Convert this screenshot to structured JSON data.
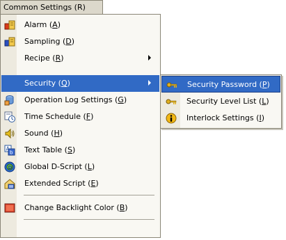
{
  "menubar": {
    "label": "Common Settings (R)"
  },
  "menu": {
    "items": [
      {
        "label": "Alarm (",
        "key": "A",
        "tail": ")",
        "icon": "alarm-icon"
      },
      {
        "label": "Sampling (",
        "key": "D",
        "tail": ")",
        "icon": "sampling-icon"
      },
      {
        "label": "Recipe (",
        "key": "R",
        "tail": ")",
        "icon": ""
      },
      {
        "label": "Security (",
        "key": "Q",
        "tail": ")",
        "icon": ""
      },
      {
        "label": "Operation Log Settings (",
        "key": "G",
        "tail": ")",
        "icon": "operation-log-icon"
      },
      {
        "label": "Time Schedule (",
        "key": "F",
        "tail": ")",
        "icon": "time-schedule-icon"
      },
      {
        "label": "Sound (",
        "key": "H",
        "tail": ")",
        "icon": "sound-icon"
      },
      {
        "label": "Text Table (",
        "key": "S",
        "tail": ")",
        "icon": "text-table-icon"
      },
      {
        "label": "Global D-Script (",
        "key": "L",
        "tail": ")",
        "icon": "global-d-script-icon"
      },
      {
        "label": "Extended Script (",
        "key": "E",
        "tail": ")",
        "icon": "extended-script-icon"
      },
      {
        "label": "Change Backlight Color (",
        "key": "B",
        "tail": ")",
        "icon": "backlight-color-icon"
      }
    ]
  },
  "submenu": {
    "items": [
      {
        "label": "Security Password (",
        "key": "P",
        "tail": ")",
        "icon": "key-icon"
      },
      {
        "label": "Security Level List (",
        "key": "L",
        "tail": ")",
        "icon": "key-icon"
      },
      {
        "label": "Interlock Settings (",
        "key": "I",
        "tail": ")",
        "icon": "info-icon"
      }
    ]
  },
  "colors": {
    "highlight": "#316ac5",
    "menu_bg": "#f9f8f3",
    "gutter": "#edeadf",
    "bar": "#dcd8cb"
  }
}
